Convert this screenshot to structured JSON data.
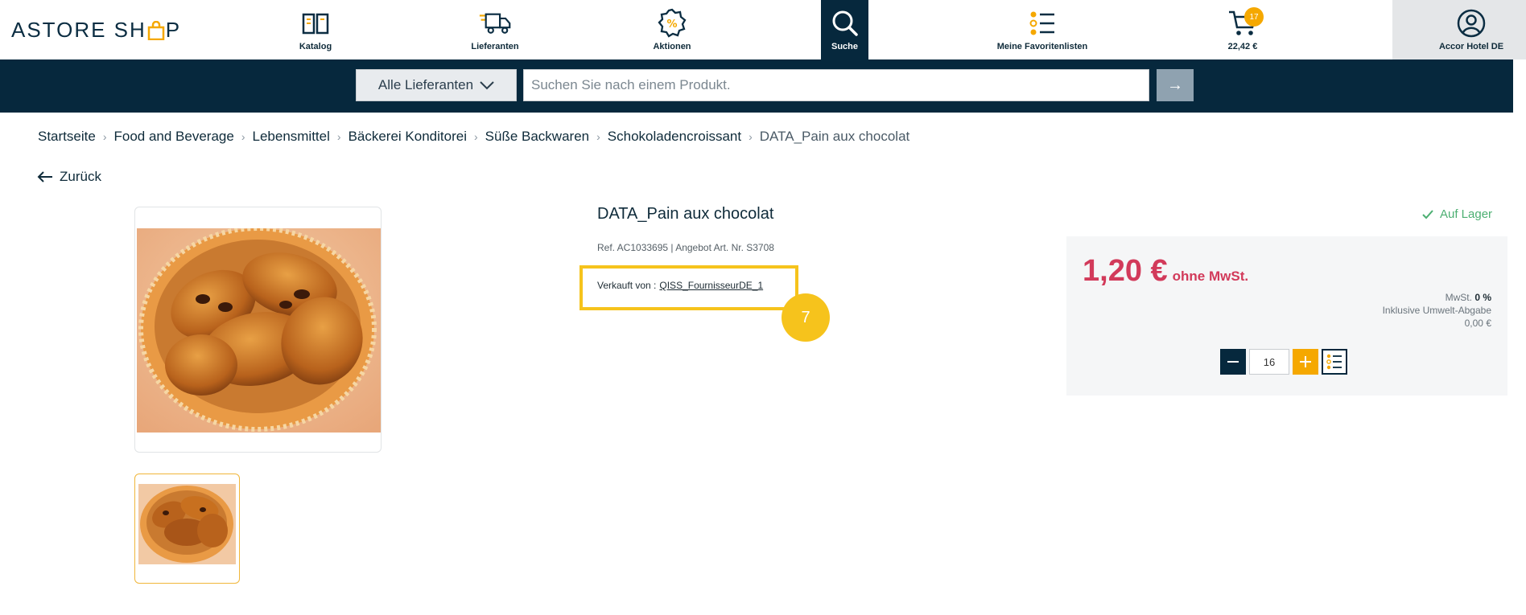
{
  "header": {
    "logo_text_left": "ASTORE SH",
    "logo_text_right": "P",
    "nav": [
      {
        "label": "Katalog",
        "icon": "book-icon"
      },
      {
        "label": "Lieferanten",
        "icon": "truck-icon"
      },
      {
        "label": "Aktionen",
        "icon": "percent-badge-icon"
      },
      {
        "label": "Suche",
        "icon": "search-icon",
        "active": true
      },
      {
        "label": "Meine Favoritenlisten",
        "icon": "list-icon"
      },
      {
        "label": "22,42 €",
        "icon": "cart-icon",
        "badge": "17"
      },
      {
        "label": "Accor Hotel DE",
        "icon": "user-icon"
      }
    ]
  },
  "search": {
    "supplier_label": "Alle Lieferanten",
    "placeholder": "Suchen Sie nach einem Produkt.",
    "value": "",
    "submit_symbol": "→"
  },
  "breadcrumb": [
    "Startseite",
    "Food and Beverage",
    "Lebensmittel",
    "Bäckerei Konditorei",
    "Süße Backwaren",
    "Schokoladencroissant"
  ],
  "breadcrumb_current": "DATA_Pain aux chocolat",
  "back_label": "Zurück",
  "product": {
    "title": "DATA_Pain aux chocolat",
    "ref": "Ref. AC1033695 | Angebot Art. Nr. S3708",
    "sold_by_label": "Verkauft von :",
    "seller": "QISS_FournisseurDE_1",
    "stock": "Auf Lager",
    "step_badge": "7"
  },
  "price": {
    "amount": "1,20 €",
    "suffix": "ohne MwSt.",
    "vat_label": "MwSt.",
    "vat_value": "0 %",
    "eco_label": "Inklusive Umwelt-Abgabe",
    "eco_value": "0,00 €",
    "quantity": "16"
  },
  "colors": {
    "navy": "#06283d",
    "accent": "#f5a800",
    "highlight": "#f6c31c",
    "price": "#d23a5a",
    "stock": "#4caf72"
  }
}
